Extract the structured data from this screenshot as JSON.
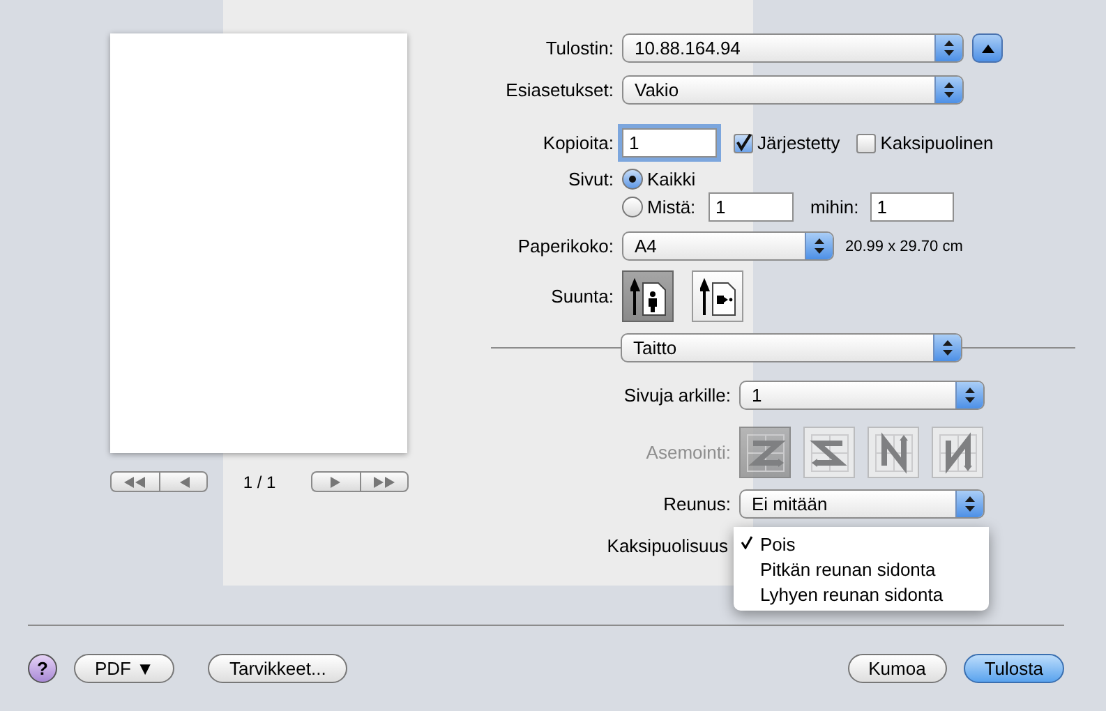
{
  "preview": {
    "page_indicator": "1 / 1"
  },
  "printer": {
    "label": "Tulostin:",
    "value": "10.88.164.94"
  },
  "presets": {
    "label": "Esiasetukset:",
    "value": "Vakio"
  },
  "copies": {
    "label": "Kopioita:",
    "value": "1"
  },
  "collated": {
    "label": "Järjestetty",
    "checked": true
  },
  "two_sided": {
    "label": "Kaksipuolinen",
    "checked": false
  },
  "pages": {
    "label": "Sivut:",
    "options": [
      {
        "label": "Kaikki",
        "selected": true
      },
      {
        "label": "Mistä:",
        "selected": false
      }
    ],
    "from": "1",
    "to_label": "mihin:",
    "to": "1"
  },
  "paper_size": {
    "label": "Paperikoko:",
    "value": "A4",
    "dimensions": "20.99 x 29.70 cm"
  },
  "orientation": {
    "label": "Suunta:",
    "options": [
      {
        "kind": "portrait",
        "selected": true
      },
      {
        "kind": "landscape",
        "selected": false
      }
    ]
  },
  "section": {
    "value": "Taitto"
  },
  "pages_per_sheet": {
    "label": "Sivuja arkille:",
    "value": "1"
  },
  "layout_direction": {
    "label": "Asemointi:",
    "disabled": true,
    "options": [
      {
        "kind": "z",
        "selected": true
      },
      {
        "kind": "s",
        "selected": false
      },
      {
        "kind": "n",
        "selected": false
      },
      {
        "kind": "rn",
        "selected": false
      }
    ]
  },
  "border": {
    "label": "Reunus:",
    "value": "Ei mitään"
  },
  "duplex": {
    "label": "Kaksipuolisuus",
    "menu": [
      {
        "label": "Pois",
        "selected": true
      },
      {
        "label": "Pitkän reunan sidonta",
        "selected": false
      },
      {
        "label": "Lyhyen reunan sidonta",
        "selected": false
      }
    ]
  },
  "buttons": [
    {
      "kind": "help",
      "label": "?"
    },
    {
      "kind": "menu",
      "label": "PDF ▼"
    },
    {
      "kind": "plain",
      "label": "Tarvikkeet..."
    },
    {
      "kind": "plain",
      "label": "Kumoa"
    },
    {
      "kind": "primary",
      "label": "Tulosta"
    }
  ]
}
